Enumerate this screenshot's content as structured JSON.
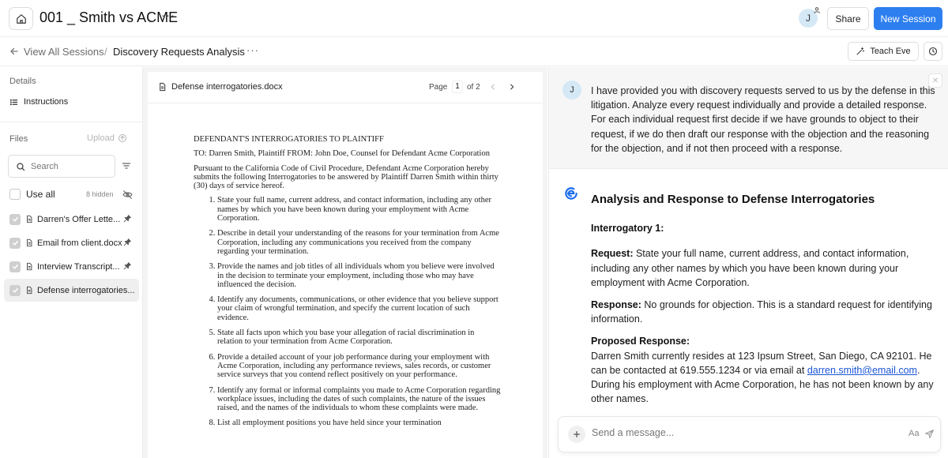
{
  "header": {
    "session_title": "001 _ Smith vs ACME",
    "more": "···",
    "user_initial": "J",
    "share_label": "Share",
    "new_session_label": "New Session"
  },
  "breadcrumb": {
    "back_label": "View All Sessions",
    "separator": "/",
    "current": "Discovery Requests Analysis",
    "more": "···",
    "teach_label": "Teach Eve"
  },
  "sidebar": {
    "details_label": "Details",
    "instructions_label": "Instructions",
    "files_label": "Files",
    "upload_label": "Upload",
    "search_placeholder": "Search",
    "use_all_label": "Use all",
    "hidden_count": "8 hidden",
    "files": [
      {
        "name": "Darren's Offer Lette...",
        "checked": true,
        "pinned": true,
        "active": false
      },
      {
        "name": "Email from client.docx",
        "checked": true,
        "pinned": true,
        "active": false
      },
      {
        "name": "Interview Transcript...",
        "checked": true,
        "pinned": true,
        "active": false
      },
      {
        "name": "Defense interrogatories...",
        "checked": true,
        "pinned": false,
        "active": true
      }
    ]
  },
  "document": {
    "filename": "Defense interrogatories.docx",
    "page_label": "Page",
    "page_current": "1",
    "page_of": "of 2",
    "heading": "DEFENDANT'S INTERROGATORIES TO PLAINTIFF",
    "to_line": "TO: Darren Smith, Plaintiff FROM: John Doe, Counsel for Defendant Acme Corporation",
    "intro": "Pursuant to the California Code of Civil Procedure, Defendant Acme Corporation hereby submits the following Interrogatories to be answered by Plaintiff Darren Smith within thirty (30) days of service hereof.",
    "items": [
      "State your full name, current address, and contact information, including any other names by which you have been known during your employment with Acme Corporation.",
      "Describe in detail your understanding of the reasons for your termination from Acme Corporation, including any communications you received from the company regarding your termination.",
      "Provide the names and job titles of all individuals whom you believe were involved in the decision to terminate your employment, including those who may have influenced the decision.",
      "Identify any documents, communications, or other evidence that you believe support your claim of wrongful termination, and specify the current location of such evidence.",
      "State all facts upon which you base your allegation of racial discrimination in relation to your termination from Acme Corporation.",
      "Provide a detailed account of your job performance during your employment with Acme Corporation, including any performance reviews, sales records, or customer service surveys that you contend reflect positively on your performance.",
      "Identify any formal or informal complaints you made to Acme Corporation regarding workplace issues, including the dates of such complaints, the nature of the issues raised, and the names of the individuals to whom these complaints were made.",
      "List all employment positions you have held since your termination"
    ]
  },
  "chat": {
    "user_initial": "J",
    "user_message": "I have provided you with discovery requests served to us by the defense in this litigation. Analyze every request individually and provide a detailed response. For each individual request first decide if we have grounds to object to their request, if we do then draft our response with the objection and the reasoning for the objection, and if not then proceed with a response.",
    "close": "✕",
    "ai_title": "Analysis and Response to Defense Interrogatories",
    "interrogatory_label": "Interrogatory 1:",
    "request_label": "Request:",
    "request_text": "State your full name, current address, and contact information, including any other names by which you have been known during your employment with Acme Corporation.",
    "response_label": "Response:",
    "response_text": "No grounds for objection. This is a standard request for identifying information.",
    "proposed_label": "Proposed Response:",
    "proposed_text_1": "Darren Smith currently resides at 123 Ipsum Street, San Diego, CA 92101. He can be contacted at 619.555.1234 or via email at",
    "proposed_email": "darren.smith@email.com",
    "proposed_text_2": ". During his employment with Acme Corporation, he has not been known by any other names.",
    "composer_placeholder": "Send a message...",
    "font_toggle": "Aa"
  },
  "colors": {
    "primary": "#2d7ff0",
    "avatar_bg": "#d5e8f6",
    "link": "#1a55d6"
  }
}
